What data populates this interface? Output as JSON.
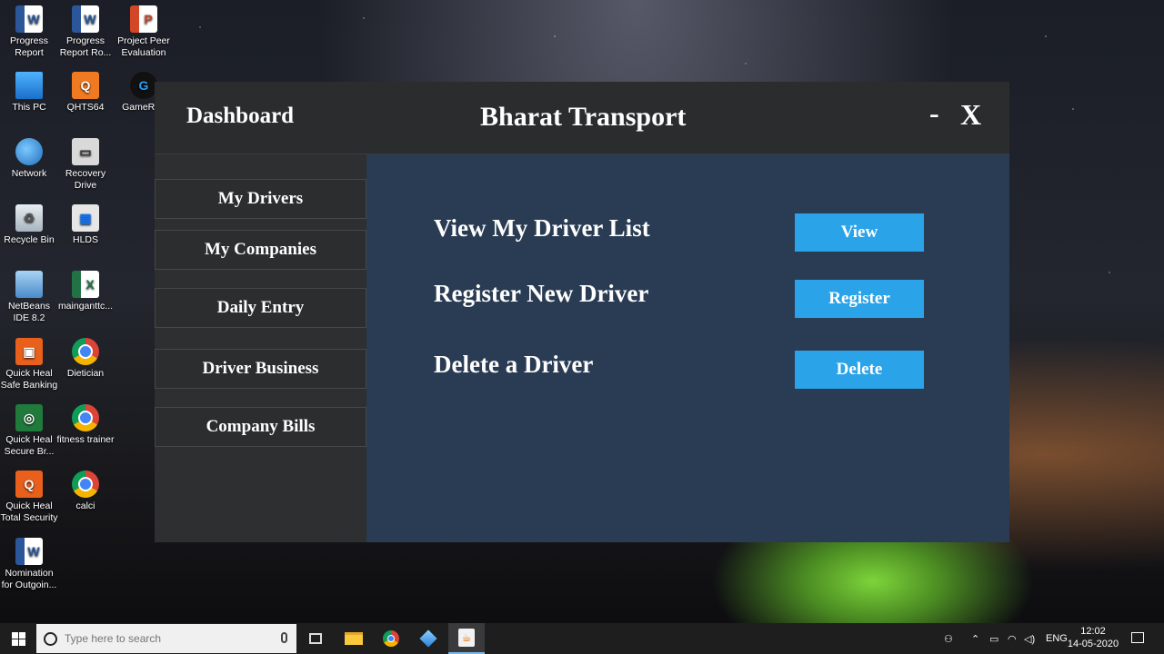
{
  "desktop": {
    "icons": [
      {
        "label": "Progress Report",
        "icon": "word-doc-icon"
      },
      {
        "label": "Progress Report Ro...",
        "icon": "word-doc-icon"
      },
      {
        "label": "Project Peer Evaluation",
        "icon": "powerpoint-icon"
      },
      {
        "label": "This PC",
        "icon": "computer-icon"
      },
      {
        "label": "QHTS64",
        "icon": "quickheal-icon"
      },
      {
        "label": "GameRan",
        "icon": "gameranger-icon"
      },
      {
        "label": "Network",
        "icon": "network-icon"
      },
      {
        "label": "Recovery Drive",
        "icon": "recovery-drive-icon"
      },
      {
        "label": "Recycle Bin",
        "icon": "recycle-bin-icon"
      },
      {
        "label": "HLDS",
        "icon": "hlds-icon"
      },
      {
        "label": "NetBeans IDE 8.2",
        "icon": "netbeans-icon"
      },
      {
        "label": "mainganttc...",
        "icon": "excel-icon"
      },
      {
        "label": "Quick Heal Safe Banking",
        "icon": "quickheal-banking-icon"
      },
      {
        "label": "Dietician",
        "icon": "chrome-icon"
      },
      {
        "label": "Quick Heal Secure Br...",
        "icon": "quickheal-browser-icon"
      },
      {
        "label": "fitness trainer",
        "icon": "chrome-icon"
      },
      {
        "label": "Quick Heal Total Security",
        "icon": "quickheal-total-icon"
      },
      {
        "label": "calci",
        "icon": "chrome-icon"
      },
      {
        "label": "Nomination for Outgoin...",
        "icon": "word-doc-icon"
      }
    ]
  },
  "app": {
    "dashboard_label": "Dashboard",
    "title": "Bharat Transport",
    "minimize_label": "-",
    "close_label": "X",
    "nav": [
      "My Drivers",
      "My Companies",
      "Daily Entry",
      "Driver Business",
      "Company Bills"
    ],
    "actions": [
      {
        "label": "View My Driver List",
        "button": "View"
      },
      {
        "label": "Register New Driver",
        "button": "Register"
      },
      {
        "label": "Delete a Driver",
        "button": "Delete"
      }
    ],
    "colors": {
      "titlebar": "#2a2c2e",
      "sidebar": "#2d2f31",
      "content": "#2a3c53",
      "button": "#2aa3e8"
    }
  },
  "taskbar": {
    "search_placeholder": "Type here to search",
    "language": "ENG",
    "time": "12:02",
    "date": "14-05-2020"
  }
}
